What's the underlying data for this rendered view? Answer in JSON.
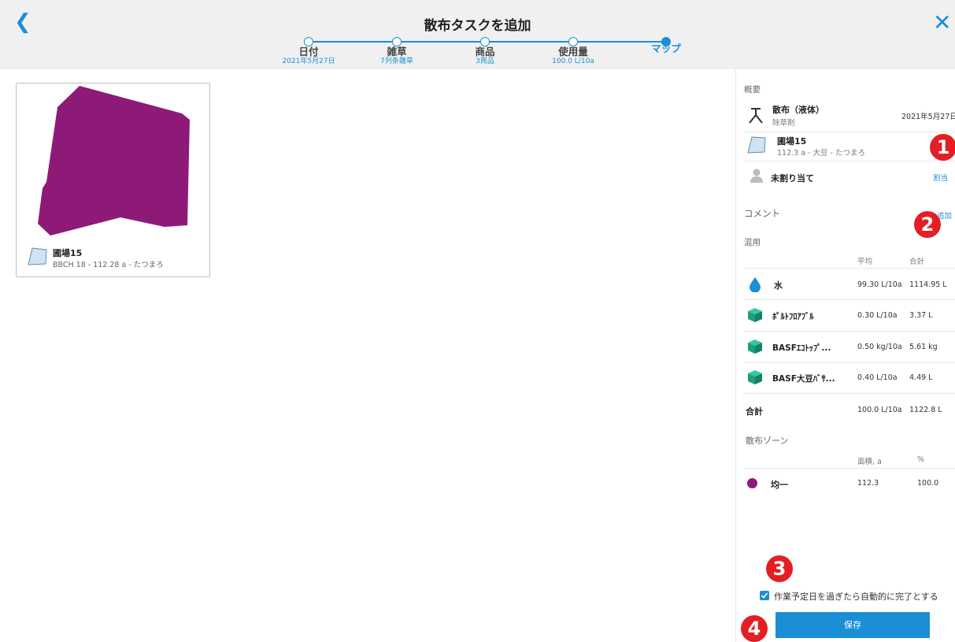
{
  "header": {
    "title": "散布タスクを追加",
    "back_icon": "chevron-left-icon",
    "close_icon": "close-icon"
  },
  "steps": [
    {
      "label": "日付",
      "sub": "2021年5月27日",
      "active": false
    },
    {
      "label": "雑草",
      "sub": "7列条雑草",
      "active": false
    },
    {
      "label": "商品",
      "sub": "3商品",
      "active": false
    },
    {
      "label": "使用量",
      "sub": "100.0 L/10a",
      "active": false
    },
    {
      "label": "マップ",
      "sub": "",
      "active": true
    }
  ],
  "field_card": {
    "name": "圃場15",
    "meta": "BBCH 18 - 112.28 a - たつまろ",
    "fill_color": "#8e1a78"
  },
  "panel": {
    "overview_title": "概要",
    "spray_type": "散布（液体）",
    "spray_sub": "除草剤",
    "spray_date": "2021年5月27日",
    "field_name": "圃場15",
    "field_meta": "112.3 a - 大豆 - たつまろ",
    "assignee": "未割り当て",
    "assign_link": "割当",
    "comment_title": "コメント",
    "comment_link": "追加",
    "mix_title": "混用",
    "col_avg": "平均",
    "col_total": "合計",
    "mix_rows": [
      {
        "icon": "water-drop-icon",
        "name": "水",
        "avg": "99.30 L/10a",
        "total": "1114.95 L"
      },
      {
        "icon": "product-cube-icon",
        "name": "ﾎﾟﾙﾄﾌﾛｱﾌﾞﾙ",
        "avg": "0.30 L/10a",
        "total": "3.37 L"
      },
      {
        "icon": "product-cube-icon",
        "name": "BASFｴｺﾄｯﾌﾟ...",
        "avg": "0.50 kg/10a",
        "total": "5.61 kg"
      },
      {
        "icon": "product-cube-icon",
        "name": "BASF大豆ﾊﾞｻ...",
        "avg": "0.40 L/10a",
        "total": "4.49 L"
      }
    ],
    "total_label": "合計",
    "total_avg": "100.0 L/10a",
    "total_sum": "1122.8 L",
    "zone_title": "散布ゾーン",
    "col_area": "面積, a",
    "col_pct": "%",
    "zone_name": "均一",
    "zone_area": "112.3",
    "zone_pct": "100.0",
    "zone_color": "#8e1a78",
    "auto_complete_label": "作業予定日を過ぎたら自動的に完了とする",
    "auto_complete_checked": true,
    "save_label": "保存"
  },
  "badges": [
    "1",
    "2",
    "3",
    "4"
  ],
  "accent_color": "#1a8fd6",
  "badge_color": "#e31e24"
}
